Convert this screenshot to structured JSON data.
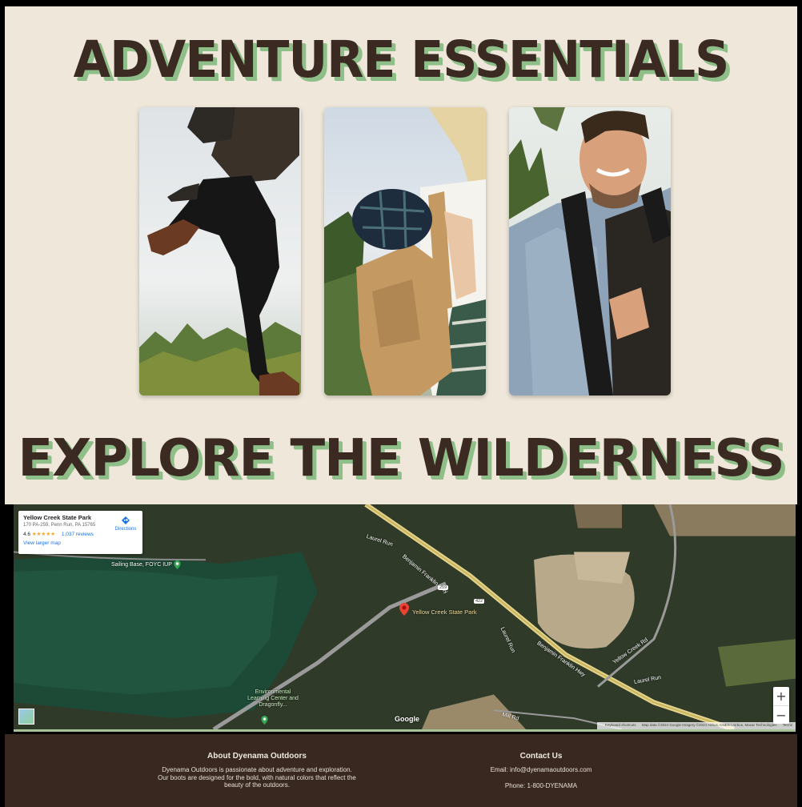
{
  "sections": {
    "essentials_title": "ADVENTURE ESSENTIALS",
    "wilderness_title": "EXPLORE THE WILDERNESS"
  },
  "colors": {
    "cream_background": "#efe8da",
    "title_brown": "#3b2a22",
    "title_shadow_green": "#8fbf89",
    "footer_background": "#382820"
  },
  "map": {
    "place_name": "Yellow Creek State Park",
    "address": "170 PA-259, Penn Run, PA 15765",
    "rating": "4.6",
    "stars": "★★★★★",
    "reviews": "1,037 reviews",
    "directions_label": "Directions",
    "larger_map_label": "View larger map",
    "pin_label": "Yellow Creek State Park",
    "labels": {
      "sailing_base": "Sailing Base, FOYC IUP",
      "laurel_run_1": "Laurel Run",
      "laurel_run_2": "Laurel Run",
      "laurel_run_3": "Laurel Run",
      "benjamin_franklin_1": "Benjamin Franklin Hwy",
      "benjamin_franklin_2": "Benjamin Franklin Hwy",
      "yellow_creek_rd": "Yellow Creek Rd",
      "mill_rd": "Mill Rd",
      "env_center": "Environmental Learning Center and Dragonfly...",
      "route_259": "259",
      "route_422": "422"
    },
    "zoom_in": "+",
    "zoom_out": "−",
    "google_logo": "Google",
    "attribution": {
      "shortcuts": "Keyboard shortcuts",
      "map_data": "Map data ©2024 Google Imagery ©2024 Airbus, CNES / Airbus, Maxar Technologies",
      "terms": "Terms"
    }
  },
  "footer": {
    "about_title": "About Dyenama Outdoors",
    "about_text": "Dyenama Outdoors is passionate about adventure and exploration. Our boots are designed for the bold, with natural colors that reflect the beauty of the outdoors.",
    "contact_title": "Contact Us",
    "email": "Email: info@dyenamaoutdoors.com",
    "phone": "Phone: 1-800-DYENAMA"
  },
  "icons": [
    "directions-icon",
    "map-pin-icon",
    "sailing-pin-icon",
    "env-center-pin-icon"
  ]
}
